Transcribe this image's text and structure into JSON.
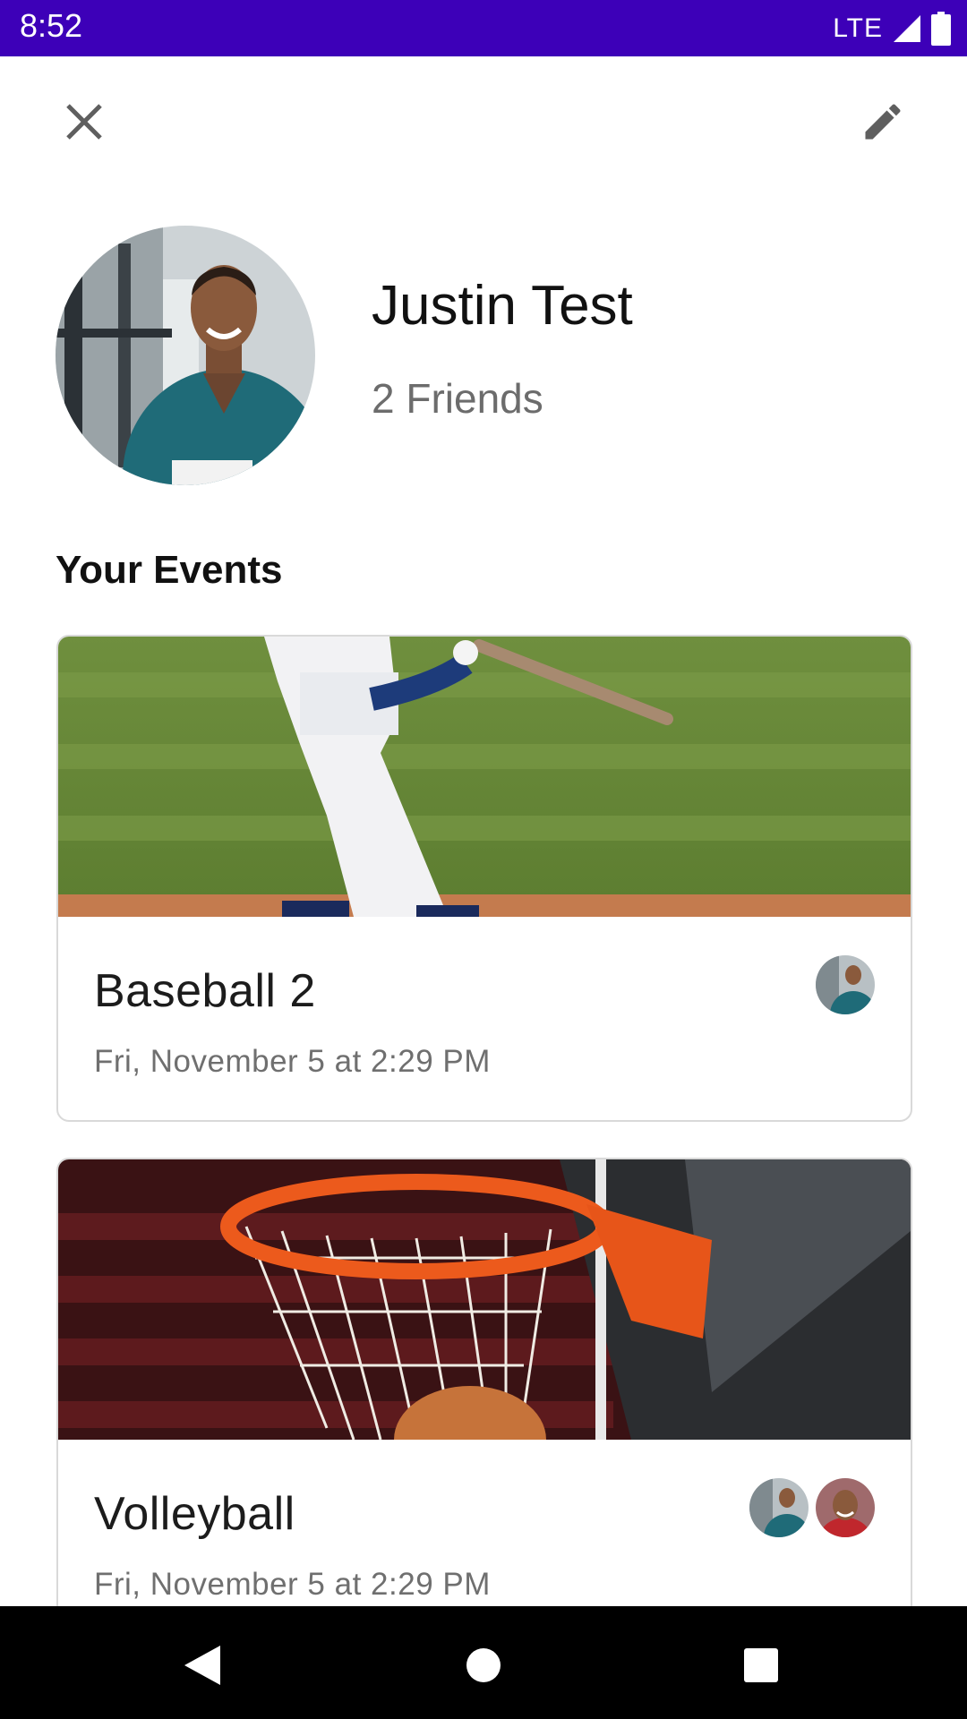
{
  "status_bar": {
    "time": "8:52",
    "network": "LTE"
  },
  "header": {
    "close_icon": "close-icon",
    "edit_icon": "edit-pencil-icon"
  },
  "profile": {
    "name": "Justin Test",
    "friends": "2 Friends"
  },
  "section": {
    "title": "Your Events"
  },
  "events": [
    {
      "title": "Baseball 2",
      "date": "Fri, November 5 at 2:29 PM",
      "attendee_count": 1
    },
    {
      "title": "Volleyball",
      "date": "Fri, November 5 at 2:29 PM",
      "attendee_count": 2
    }
  ],
  "colors": {
    "status_bar": "#3d00b8",
    "nav_bar": "#000000"
  }
}
